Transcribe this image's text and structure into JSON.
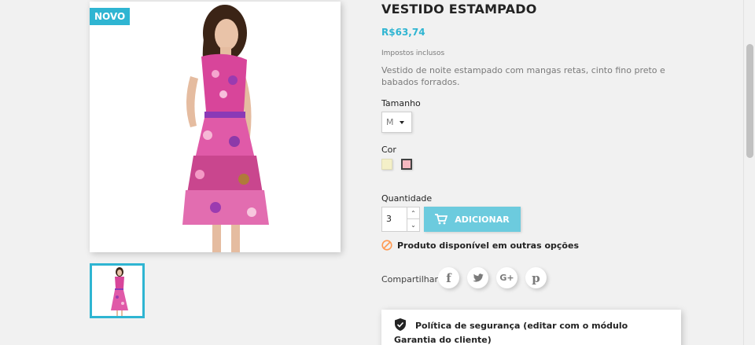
{
  "product": {
    "flag": "NOVO",
    "title": "VESTIDO ESTAMPADO",
    "price": "R$63,74",
    "tax_label": "Impostos inclusos",
    "description": "Vestido de noite estampado com mangas retas, cinto fino preto e babados forrados."
  },
  "variants": {
    "size_label": "Tamanho",
    "size_value": "M",
    "color_label": "Cor",
    "colors": [
      "#f4f0c8",
      "#f6b8c0"
    ]
  },
  "quantity": {
    "label": "Quantidade",
    "value": "3",
    "up": "⌃",
    "down": "⌄"
  },
  "add_to_cart": {
    "label": "ADICIONAR"
  },
  "availability": {
    "text": "Produto disponível em outras opções"
  },
  "share": {
    "label": "Compartilhar",
    "facebook": "f",
    "twitter": "t",
    "google": "G+",
    "pinterest": "p"
  },
  "reassurance": {
    "text": "Política de segurança (editar com o módulo Garantia do cliente)"
  },
  "colors": {
    "accent": "#2fb5d2",
    "button": "#6ccbde",
    "warning": "#ff9a52"
  }
}
